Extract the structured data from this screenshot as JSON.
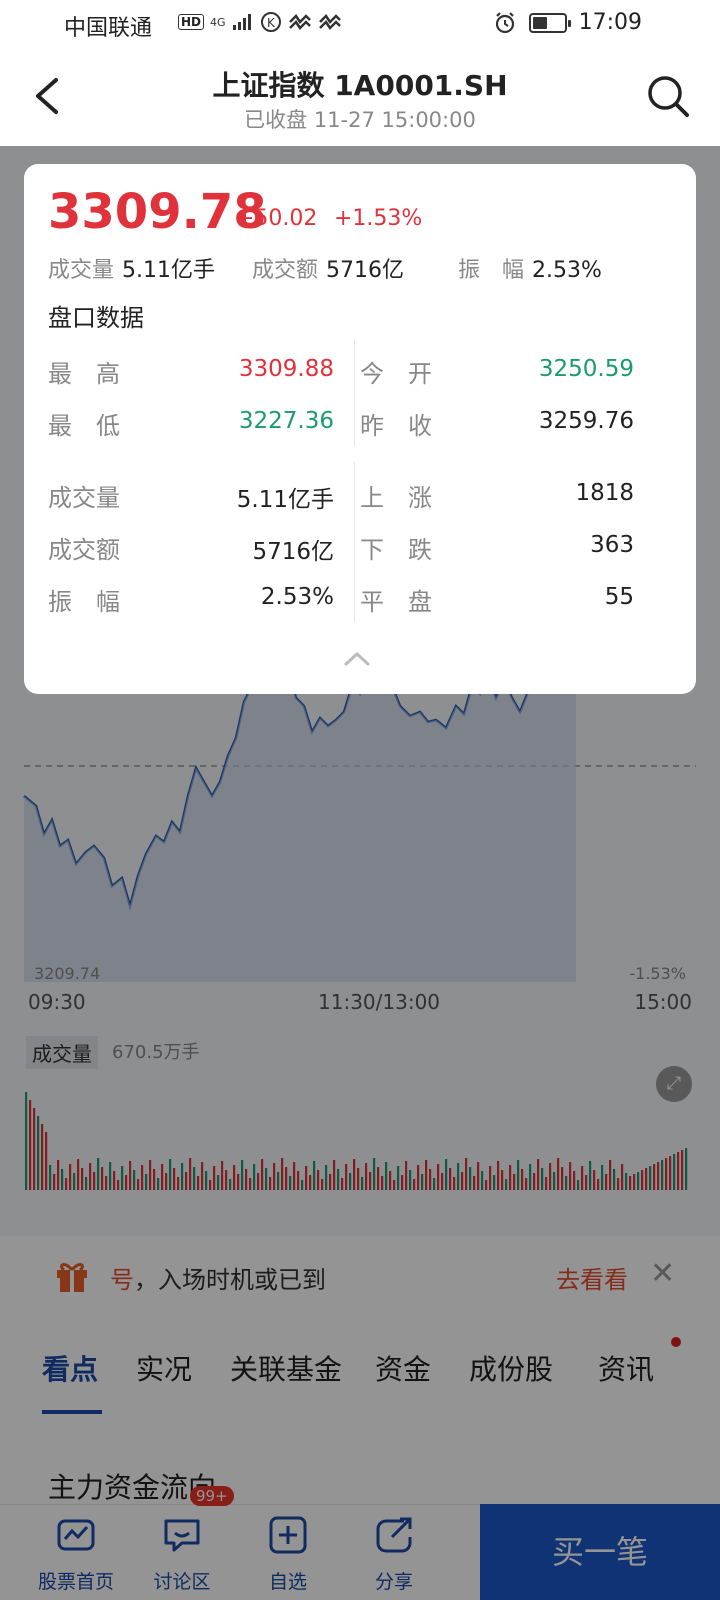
{
  "status_bar": {
    "carrier": "中国联通",
    "hd": "HD",
    "network": "4G",
    "time": "17:09"
  },
  "header": {
    "title": "上证指数 1A0001.SH",
    "subtitle": "已收盘 11-27 15:00:00"
  },
  "quote": {
    "price": "3309.78",
    "change": "+50.02",
    "change_pct": "+1.53%",
    "summary": [
      {
        "label": "成交量",
        "value": "5.11亿手"
      },
      {
        "label": "成交额",
        "value": "5716亿"
      },
      {
        "label": "振　幅",
        "value": "2.53%"
      }
    ]
  },
  "order_book": {
    "section_title": "盘口数据",
    "left_top": [
      {
        "label": "最　高",
        "value": "3309.88",
        "color": "#e0323a"
      },
      {
        "label": "最　低",
        "value": "3227.36",
        "color": "#1a9b6e"
      }
    ],
    "right_top": [
      {
        "label": "今　开",
        "value": "3250.59",
        "color": "#1a9b6e"
      },
      {
        "label": "昨　收",
        "value": "3259.76",
        "color": "#222222"
      }
    ],
    "left_bottom": [
      {
        "label": "成交量",
        "value": "5.11亿手"
      },
      {
        "label": "成交额",
        "value": "5716亿"
      },
      {
        "label": "振　幅",
        "value": "2.53%"
      }
    ],
    "right_bottom": [
      {
        "label": "上　涨",
        "value": "1818"
      },
      {
        "label": "下　跌",
        "value": "363"
      },
      {
        "label": "平　盘",
        "value": "55"
      }
    ]
  },
  "chart": {
    "low_price": "3209.74",
    "low_pct": "-1.53%",
    "time_start": "09:30",
    "time_mid": "11:30/13:00",
    "time_end": "15:00",
    "volume_label": "成交量",
    "volume_value": "670.5万手"
  },
  "promo": {
    "highlight": "号",
    "text": "，入场时机或已到",
    "link": "去看看"
  },
  "tabs": [
    "看点",
    "实况",
    "关联基金",
    "资金",
    "成份股",
    "资讯"
  ],
  "section_title": "主力资金流向",
  "bottom_nav": {
    "items": [
      "股票首页",
      "讨论区",
      "自选",
      "分享"
    ],
    "badge": "99+",
    "buy": "买一笔"
  },
  "colors": {
    "up": "#e0323a",
    "down": "#1a9b6e",
    "accent": "#1b59c9",
    "line": "#2b5fb5"
  }
}
